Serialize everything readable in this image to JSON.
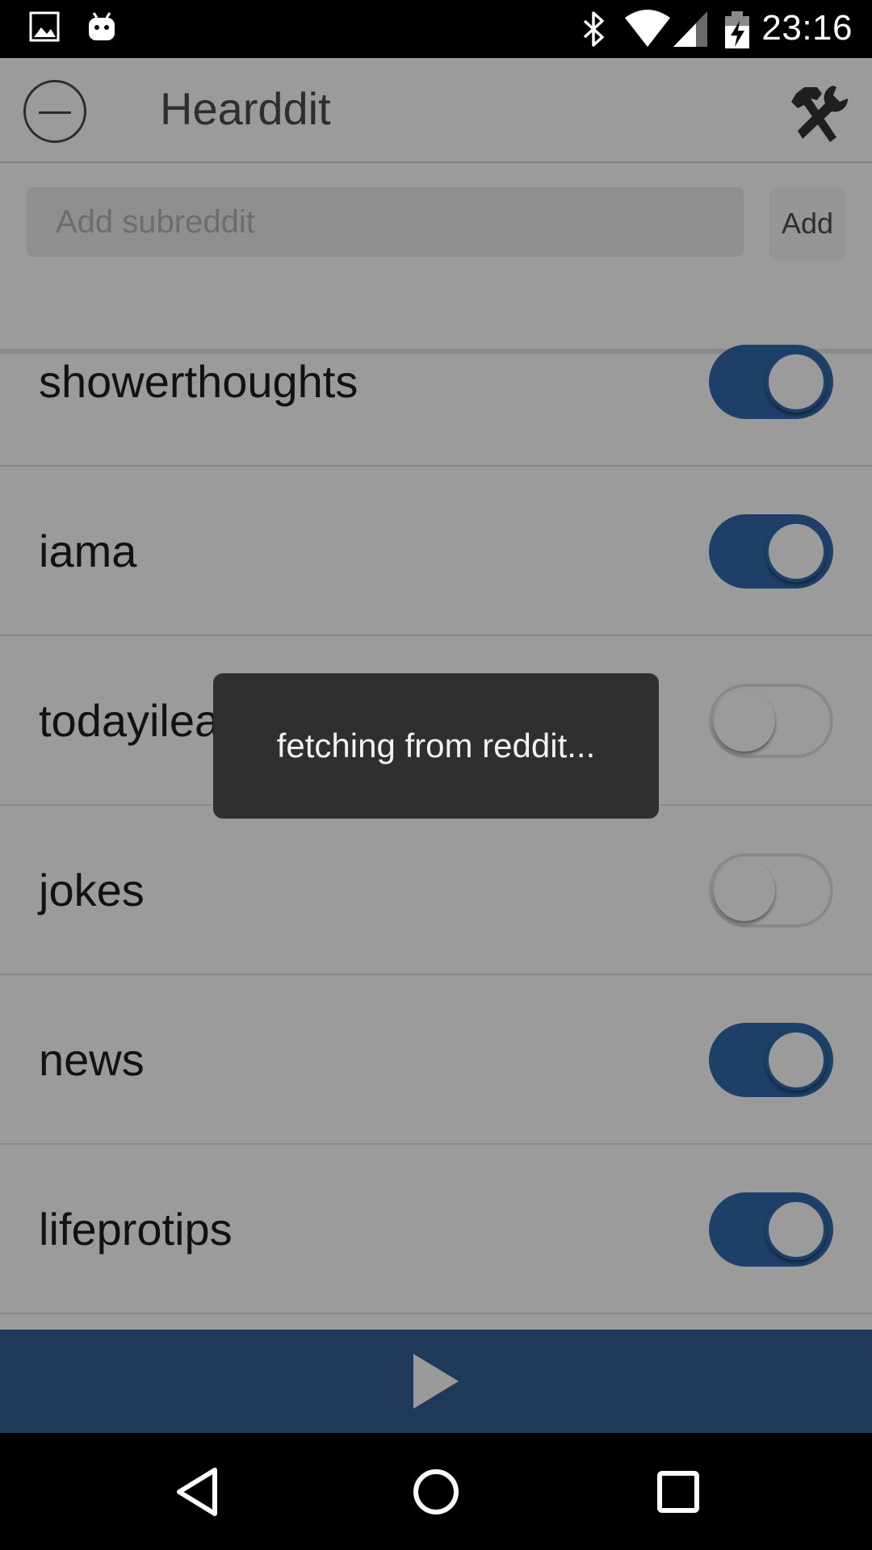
{
  "status_bar": {
    "time": "23:16",
    "icons": [
      "image-icon",
      "android-icon",
      "bluetooth-icon",
      "wifi-icon",
      "signal-icon",
      "battery-charging-icon"
    ]
  },
  "toolbar": {
    "title": "Hearddit",
    "menu_icon": "minus-circle-icon",
    "settings_icon": "tools-icon"
  },
  "add_subreddit": {
    "placeholder": "Add subreddit",
    "value": "",
    "button_label": "Add"
  },
  "subreddits": [
    {
      "name": "showerthoughts",
      "enabled": true
    },
    {
      "name": "iama",
      "enabled": true
    },
    {
      "name": "todayilearned",
      "enabled": false
    },
    {
      "name": "jokes",
      "enabled": false
    },
    {
      "name": "news",
      "enabled": true
    },
    {
      "name": "lifeprotips",
      "enabled": true
    }
  ],
  "toast": {
    "message": "fetching from reddit..."
  },
  "player": {
    "play_icon": "play-icon"
  },
  "nav": {
    "icons": [
      "back-icon",
      "home-icon",
      "recents-icon"
    ]
  },
  "colors": {
    "accent": "#1e4068",
    "player_bar": "#1e3a58",
    "dimmed_background": "#9b9b9b",
    "toast_background": "#2f2f2f"
  }
}
